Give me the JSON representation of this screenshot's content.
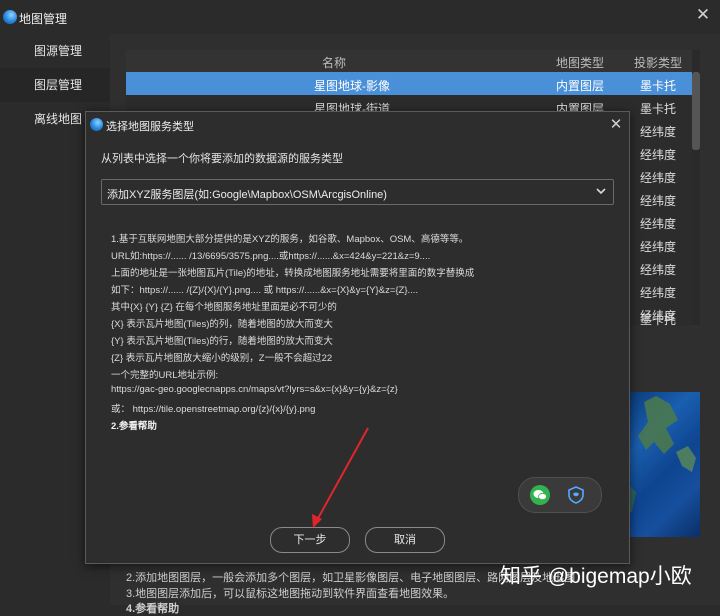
{
  "app": {
    "title": "地图管理"
  },
  "sidebar": {
    "items": [
      {
        "label": "图源管理"
      },
      {
        "label": "图层管理"
      },
      {
        "label": "离线地图"
      }
    ]
  },
  "table": {
    "headers": {
      "name": "名称",
      "map_type": "地图类型",
      "projection": "投影类型"
    },
    "rows": [
      {
        "name": "星图地球-影像",
        "map_type": "内置图层",
        "projection": "墨卡托"
      },
      {
        "name": "星图地球-街道",
        "map_type": "内置图层",
        "projection": "墨卡托"
      },
      {
        "name": "",
        "map_type": "",
        "projection": "经纬度"
      },
      {
        "name": "",
        "map_type": "",
        "projection": "经纬度"
      },
      {
        "name": "",
        "map_type": "",
        "projection": "经纬度"
      },
      {
        "name": "",
        "map_type": "",
        "projection": "经纬度"
      },
      {
        "name": "",
        "map_type": "",
        "projection": "经纬度"
      },
      {
        "name": "",
        "map_type": "",
        "projection": "经纬度"
      },
      {
        "name": "",
        "map_type": "",
        "projection": "经纬度"
      },
      {
        "name": "",
        "map_type": "",
        "projection": "经纬度"
      },
      {
        "name": "",
        "map_type": "",
        "projection": "经纬度"
      },
      {
        "name": "",
        "map_type": "",
        "projection": "墨卡托"
      }
    ]
  },
  "background": {
    "line1": "2.添加地图图层，一般会添加多个图层，如卫星影像图层、电子地图图层、路网图层及地形图",
    "line2": "3.地图图层添加后，可以鼠标这地图拖动到软件界面查看地图效果。",
    "line3": "4.参看帮助"
  },
  "dialog": {
    "title": "选择地图服务类型",
    "prompt": "从列表中选择一个你将要添加的数据源的服务类型",
    "select_value": "添加XYZ服务图层(如:Google\\Mapbox\\OSM\\ArcgisOnline)",
    "info_lines": [
      "1.基于互联网地图大部分提供的是XYZ的服务，如谷歌、Mapbox、OSM、高德等等。",
      "URL如:https://...... /13/6695/3575.png....或https://......&x=424&y=221&z=9....",
      "上面的地址是一张地图瓦片(Tile)的地址，转换成地图服务地址需要将里面的数字替换成",
      "如下：https://...... /{Z}/{X}/{Y}.png.... 或 https://......&x={X}&y={Y}&z={Z}....",
      "其中{X} {Y} {Z} 在每个地图服务地址里面是必不可少的",
      "{X} 表示瓦片地图(Tiles)的列，随着地图的放大而变大",
      "{Y} 表示瓦片地图(Tiles)的行，随着地图的放大而变大",
      "{Z} 表示瓦片地图放大缩小的级别，Z一般不会超过22",
      "一个完整的URL地址示例:",
      "https://gac-geo.googlecnapps.cn/maps/vt?lyrs=s&x={x}&y={y}&z={z}",
      "或： https://tile.openstreetmap.org/{z}/{x}/{y}.png"
    ],
    "help_heading": "2.参看帮助",
    "next_label": "下一步",
    "cancel_label": "取消"
  },
  "watermark": "知乎 @bigemap小欧",
  "colors": {
    "selected_row": "#4a90d9",
    "arrow": "#e0262b",
    "wechat": "#33b34f"
  }
}
